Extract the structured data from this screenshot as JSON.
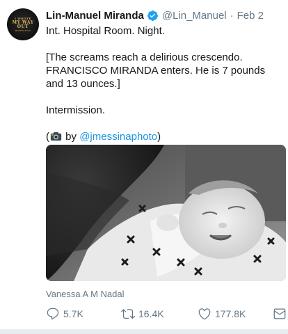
{
  "tweet": {
    "author_name": "Lin-Manuel Miranda",
    "handle": "@Lin_Manuel",
    "dot": "·",
    "date": "Feb 2",
    "avatar_text": [
      "I WROTE",
      "MY WAY",
      "OUT",
      "HAMILTON"
    ],
    "lines": {
      "l1": "Int. Hospital Room. Night.",
      "l2": "[The screams reach a delirious crescendo. FRANCISCO MIRANDA enters. He is 7 pounds and 13 ounces.]",
      "l3": "Intermission.",
      "photo_open": "(",
      "photo_by": " by ",
      "photo_link": "@jmessinaphoto",
      "photo_close": ")"
    },
    "media_caption": "Vanessa A M Nadal",
    "stats": {
      "replies": "5.7K",
      "retweets": "16.4K",
      "likes": "177.8K"
    },
    "icons": {
      "verified": "verified-badge-icon",
      "camera": "camera-icon",
      "reply": "reply-icon",
      "retweet": "retweet-icon",
      "like": "heart-icon",
      "dm": "direct-message-icon"
    },
    "colors": {
      "link": "#1b95e0",
      "verified": "#1da1f2",
      "muted": "#657786"
    }
  }
}
